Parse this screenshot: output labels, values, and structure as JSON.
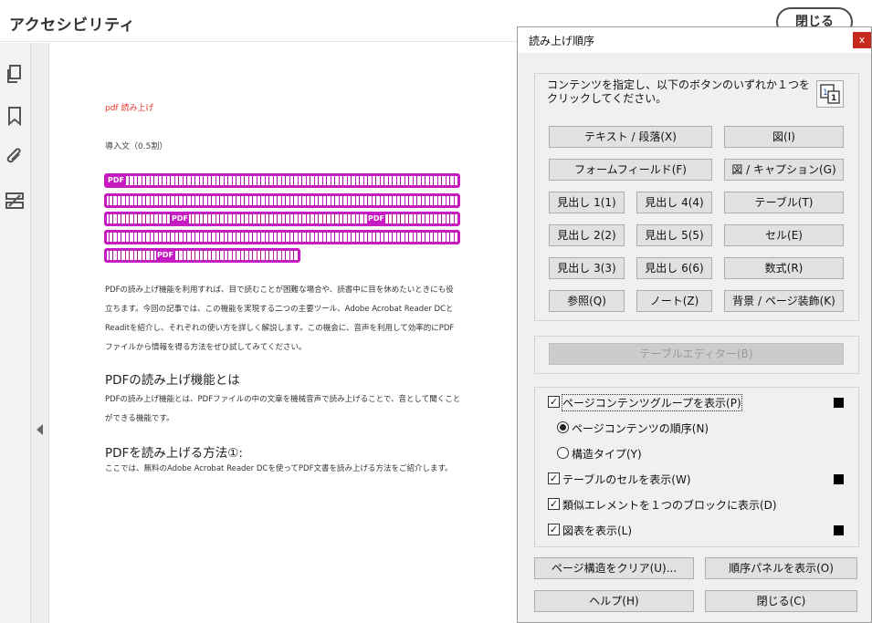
{
  "header": {
    "title": "アクセシビリティ",
    "close_label": "閉じる"
  },
  "document": {
    "small_title": "pdf 読み上げ",
    "intro": "導入文（0.5割）",
    "highlight_pdf_tag": "PDF",
    "para1": "PDFの読み上げ機能を利用すれば、目で読むことが困難な場合や、読書中に目を休めたいときにも役立ちます。今回の記事では、この機能を実現する二つの主要ツール、Adobe Acrobat Reader DCとReaditを紹介し、それぞれの使い方を詳しく解説します。この機会に、音声を利用して効率的にPDFファイルから情報を得る方法をぜひ試してみてください。",
    "heading1": "PDFの読み上げ機能とは",
    "para2": "PDFの読み上げ機能とは、PDFファイルの中の文章を機械音声で読み上げることで、音として聞くことができる機能です。",
    "heading2": "PDFを読み上げる方法①:",
    "para3": "ここでは、無料のAdobe Acrobat Reader DCを使ってPDF文書を読み上げる方法をご紹介します。"
  },
  "dialog": {
    "title": "読み上げ順序",
    "close_x": "x",
    "instruction": "コンテンツを指定し、以下のボタンのいずれか１つをクリックしてください。",
    "buttons": {
      "text_paragraph": "テキスト / 段落(X)",
      "figure": "図(I)",
      "form_field": "フォームフィールド(F)",
      "figure_caption": "図 / キャプション(G)",
      "heading1": "見出し 1(1)",
      "heading4": "見出し 4(4)",
      "table": "テーブル(T)",
      "heading2": "見出し 2(2)",
      "heading5": "見出し 5(5)",
      "cell": "セル(E)",
      "heading3": "見出し 3(3)",
      "heading6": "見出し 6(6)",
      "formula": "数式(R)",
      "reference": "参照(Q)",
      "note": "ノート(Z)",
      "background": "背景 / ページ装飾(K)",
      "table_editor": "テーブルエディター(B)"
    },
    "options": {
      "show_content_groups": {
        "label": "ページコンテンツグループを表示(P)",
        "checked": true,
        "swatch": "#000000"
      },
      "content_order": {
        "label": "ページコンテンツの順序(N)",
        "selected": true
      },
      "structure_type": {
        "label": "構造タイプ(Y)",
        "selected": false
      },
      "show_table_cells": {
        "label": "テーブルのセルを表示(W)",
        "checked": true,
        "swatch": "#000000"
      },
      "similar_elements": {
        "label": "類似エレメントを１つのブロックに表示(D)",
        "checked": true
      },
      "show_tables_figures": {
        "label": "図表を表示(L)",
        "checked": true,
        "swatch": "#000000"
      }
    },
    "footer": {
      "clear_structure": "ページ構造をクリア(U)...",
      "show_order_panel": "順序パネルを表示(O)",
      "help": "ヘルプ(H)",
      "close": "閉じる(C)"
    }
  },
  "colors": {
    "highlight": "#c71bc2",
    "red_title": "#e8342b",
    "close_x_bg": "#c42b1c"
  },
  "icons": [
    "pages-icon",
    "bookmark-icon",
    "attachment-icon",
    "structure-icon",
    "collapse-arrow-icon",
    "touchup-order-icon"
  ]
}
